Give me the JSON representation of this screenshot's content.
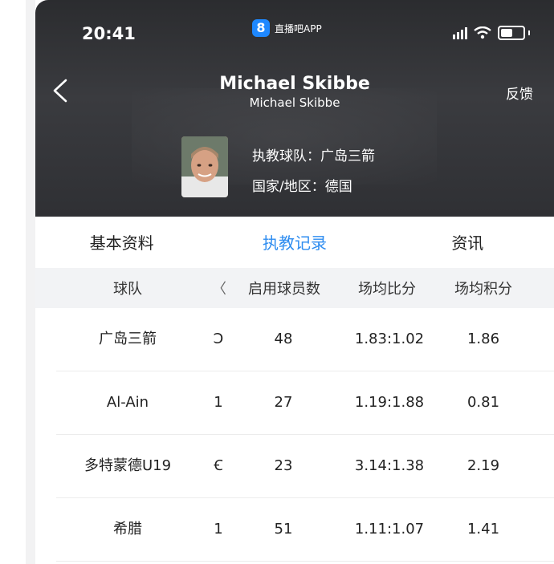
{
  "status_bar": {
    "time": "20:41",
    "app_badge": "8",
    "app_name": "直播吧APP"
  },
  "nav": {
    "title": "Michael Skibbe",
    "subtitle": "Michael Skibbe",
    "feedback": "反馈"
  },
  "coach": {
    "team_line": "执教球队：广岛三箭",
    "country_line": "国家/地区：德国"
  },
  "tabs": [
    {
      "label": "基本资料",
      "active": false
    },
    {
      "label": "执教记录",
      "active": true
    },
    {
      "label": "资讯",
      "active": false
    }
  ],
  "table": {
    "headers": {
      "team": "球队",
      "scroll_left": "〈",
      "players_used": "启用球员数",
      "avg_score": "场均比分",
      "avg_points": "场均积分"
    },
    "rows": [
      {
        "team": "广岛三箭",
        "partial": "Ͻ",
        "players": "48",
        "score": "1.83:1.02",
        "points": "1.86"
      },
      {
        "team": "Al-Ain",
        "partial": "1",
        "players": "27",
        "score": "1.19:1.88",
        "points": "0.81"
      },
      {
        "team": "多特蒙德U19",
        "partial": "Ꞓ",
        "players": "23",
        "score": "3.14:1.38",
        "points": "2.19"
      },
      {
        "team": "希腊",
        "partial": "1",
        "players": "51",
        "score": "1.11:1.07",
        "points": "1.41"
      }
    ]
  },
  "colors": {
    "accent": "#2d8cf0",
    "header_bg": "#2f3034",
    "table_head_bg": "#f2f3f5"
  }
}
